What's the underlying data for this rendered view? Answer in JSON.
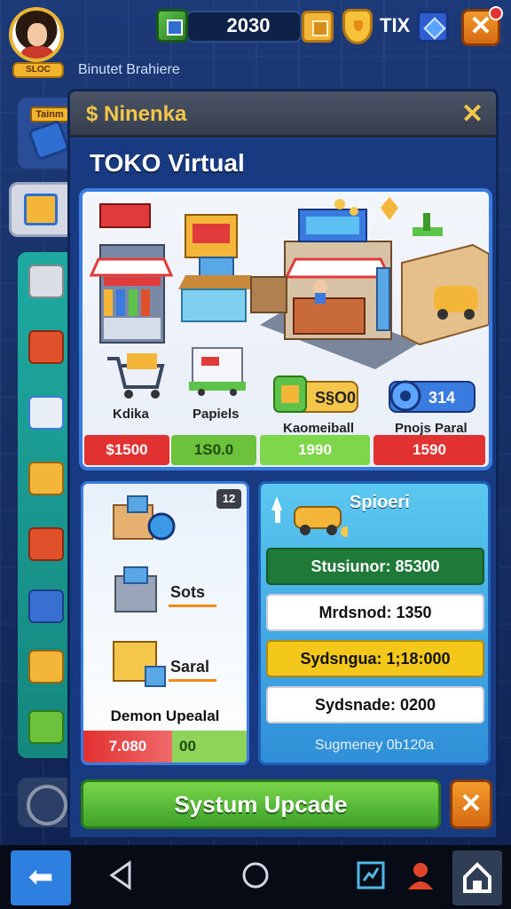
{
  "header": {
    "player_badge": "SLOC",
    "player_name": "Binutet Brahiere",
    "currency_value": "2030",
    "secondary_label": "TIX",
    "close_label": "✕"
  },
  "sidebar": {
    "tab_label": "Tainm"
  },
  "modal": {
    "title": "$ Ninenka",
    "close_label": "✕",
    "shop_title": "TOKO Virtual"
  },
  "shop": {
    "items": [
      {
        "label": "Kdika"
      },
      {
        "label": "Papiels"
      },
      {
        "label": "Kaomeiball"
      },
      {
        "label": "Pnojs Paral"
      }
    ],
    "badges": [
      {
        "value": "S§O0"
      },
      {
        "value": "314"
      }
    ],
    "prices": [
      "$1500",
      "1S0.0",
      "1990",
      "1590"
    ]
  },
  "bundle": {
    "count_badge": "12",
    "items": [
      {
        "label": "Sots"
      },
      {
        "label": "Saral"
      }
    ],
    "title": "Demon Upealal",
    "price_left": "7.080",
    "price_right": "00"
  },
  "upgrade": {
    "title": "Spioeri",
    "stats": [
      {
        "label": "Stusiunor: 85300"
      },
      {
        "label": "Mrdsnod: 1350"
      },
      {
        "label": "Sydsngua: 1;18:000"
      },
      {
        "label": "Sydsnade: 0200"
      }
    ],
    "footer": "Sugmeney 0b120a"
  },
  "actions": {
    "primary_label": "Systum Upcade",
    "close_label": "✕"
  },
  "colors": {
    "accent_gold": "#f4c64a",
    "green": "#3ea22a",
    "orange": "#d56a12",
    "red": "#e23131",
    "blue": "#3a7be0"
  }
}
